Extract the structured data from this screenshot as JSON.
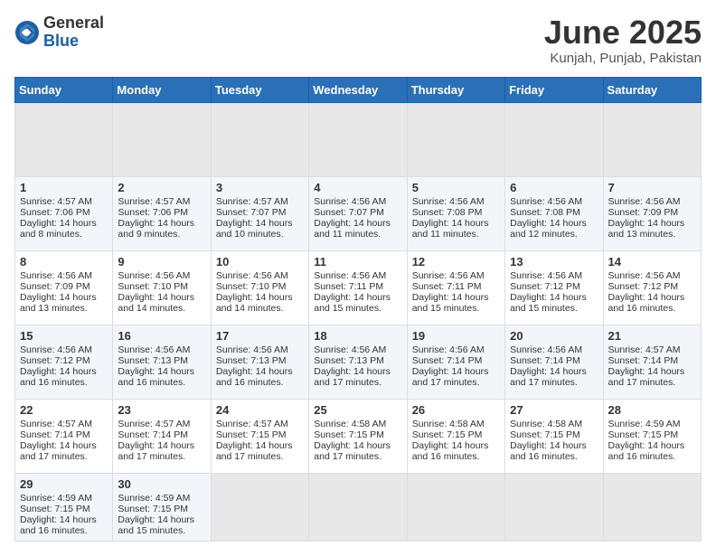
{
  "header": {
    "logo_general": "General",
    "logo_blue": "Blue",
    "month_title": "June 2025",
    "location": "Kunjah, Punjab, Pakistan"
  },
  "calendar": {
    "days_of_week": [
      "Sunday",
      "Monday",
      "Tuesday",
      "Wednesday",
      "Thursday",
      "Friday",
      "Saturday"
    ],
    "weeks": [
      [
        {
          "day": "",
          "empty": true
        },
        {
          "day": "",
          "empty": true
        },
        {
          "day": "",
          "empty": true
        },
        {
          "day": "",
          "empty": true
        },
        {
          "day": "",
          "empty": true
        },
        {
          "day": "",
          "empty": true
        },
        {
          "day": "",
          "empty": true
        }
      ],
      [
        {
          "day": "1",
          "sunrise": "4:57 AM",
          "sunset": "7:06 PM",
          "daylight": "14 hours and 8 minutes."
        },
        {
          "day": "2",
          "sunrise": "4:57 AM",
          "sunset": "7:06 PM",
          "daylight": "14 hours and 9 minutes."
        },
        {
          "day": "3",
          "sunrise": "4:57 AM",
          "sunset": "7:07 PM",
          "daylight": "14 hours and 10 minutes."
        },
        {
          "day": "4",
          "sunrise": "4:56 AM",
          "sunset": "7:07 PM",
          "daylight": "14 hours and 11 minutes."
        },
        {
          "day": "5",
          "sunrise": "4:56 AM",
          "sunset": "7:08 PM",
          "daylight": "14 hours and 11 minutes."
        },
        {
          "day": "6",
          "sunrise": "4:56 AM",
          "sunset": "7:08 PM",
          "daylight": "14 hours and 12 minutes."
        },
        {
          "day": "7",
          "sunrise": "4:56 AM",
          "sunset": "7:09 PM",
          "daylight": "14 hours and 13 minutes."
        }
      ],
      [
        {
          "day": "8",
          "sunrise": "4:56 AM",
          "sunset": "7:09 PM",
          "daylight": "14 hours and 13 minutes."
        },
        {
          "day": "9",
          "sunrise": "4:56 AM",
          "sunset": "7:10 PM",
          "daylight": "14 hours and 14 minutes."
        },
        {
          "day": "10",
          "sunrise": "4:56 AM",
          "sunset": "7:10 PM",
          "daylight": "14 hours and 14 minutes."
        },
        {
          "day": "11",
          "sunrise": "4:56 AM",
          "sunset": "7:11 PM",
          "daylight": "14 hours and 15 minutes."
        },
        {
          "day": "12",
          "sunrise": "4:56 AM",
          "sunset": "7:11 PM",
          "daylight": "14 hours and 15 minutes."
        },
        {
          "day": "13",
          "sunrise": "4:56 AM",
          "sunset": "7:12 PM",
          "daylight": "14 hours and 15 minutes."
        },
        {
          "day": "14",
          "sunrise": "4:56 AM",
          "sunset": "7:12 PM",
          "daylight": "14 hours and 16 minutes."
        }
      ],
      [
        {
          "day": "15",
          "sunrise": "4:56 AM",
          "sunset": "7:12 PM",
          "daylight": "14 hours and 16 minutes."
        },
        {
          "day": "16",
          "sunrise": "4:56 AM",
          "sunset": "7:13 PM",
          "daylight": "14 hours and 16 minutes."
        },
        {
          "day": "17",
          "sunrise": "4:56 AM",
          "sunset": "7:13 PM",
          "daylight": "14 hours and 16 minutes."
        },
        {
          "day": "18",
          "sunrise": "4:56 AM",
          "sunset": "7:13 PM",
          "daylight": "14 hours and 17 minutes."
        },
        {
          "day": "19",
          "sunrise": "4:56 AM",
          "sunset": "7:14 PM",
          "daylight": "14 hours and 17 minutes."
        },
        {
          "day": "20",
          "sunrise": "4:56 AM",
          "sunset": "7:14 PM",
          "daylight": "14 hours and 17 minutes."
        },
        {
          "day": "21",
          "sunrise": "4:57 AM",
          "sunset": "7:14 PM",
          "daylight": "14 hours and 17 minutes."
        }
      ],
      [
        {
          "day": "22",
          "sunrise": "4:57 AM",
          "sunset": "7:14 PM",
          "daylight": "14 hours and 17 minutes."
        },
        {
          "day": "23",
          "sunrise": "4:57 AM",
          "sunset": "7:14 PM",
          "daylight": "14 hours and 17 minutes."
        },
        {
          "day": "24",
          "sunrise": "4:57 AM",
          "sunset": "7:15 PM",
          "daylight": "14 hours and 17 minutes."
        },
        {
          "day": "25",
          "sunrise": "4:58 AM",
          "sunset": "7:15 PM",
          "daylight": "14 hours and 17 minutes."
        },
        {
          "day": "26",
          "sunrise": "4:58 AM",
          "sunset": "7:15 PM",
          "daylight": "14 hours and 16 minutes."
        },
        {
          "day": "27",
          "sunrise": "4:58 AM",
          "sunset": "7:15 PM",
          "daylight": "14 hours and 16 minutes."
        },
        {
          "day": "28",
          "sunrise": "4:59 AM",
          "sunset": "7:15 PM",
          "daylight": "14 hours and 16 minutes."
        }
      ],
      [
        {
          "day": "29",
          "sunrise": "4:59 AM",
          "sunset": "7:15 PM",
          "daylight": "14 hours and 16 minutes."
        },
        {
          "day": "30",
          "sunrise": "4:59 AM",
          "sunset": "7:15 PM",
          "daylight": "14 hours and 15 minutes."
        },
        {
          "day": "",
          "empty": true
        },
        {
          "day": "",
          "empty": true
        },
        {
          "day": "",
          "empty": true
        },
        {
          "day": "",
          "empty": true
        },
        {
          "day": "",
          "empty": true
        }
      ]
    ],
    "labels": {
      "sunrise": "Sunrise:",
      "sunset": "Sunset:",
      "daylight": "Daylight:"
    }
  }
}
